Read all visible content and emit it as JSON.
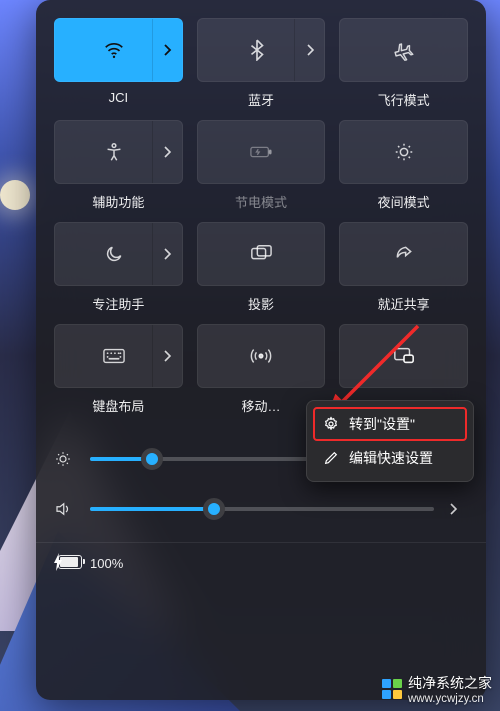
{
  "tiles": [
    {
      "id": "wifi",
      "label": "JCI",
      "icon": "wifi-icon",
      "active": true,
      "hasChevron": true,
      "disabled": false
    },
    {
      "id": "bluetooth",
      "label": "蓝牙",
      "icon": "bluetooth-icon",
      "active": false,
      "hasChevron": true,
      "disabled": false
    },
    {
      "id": "airplane",
      "label": "飞行模式",
      "icon": "airplane-icon",
      "active": false,
      "hasChevron": false,
      "disabled": false
    },
    {
      "id": "accessibility",
      "label": "辅助功能",
      "icon": "accessibility-icon",
      "active": false,
      "hasChevron": true,
      "disabled": false
    },
    {
      "id": "battery-saver",
      "label": "节电模式",
      "icon": "battery-saver-icon",
      "active": false,
      "hasChevron": false,
      "disabled": true
    },
    {
      "id": "night-light",
      "label": "夜间模式",
      "icon": "night-light-icon",
      "active": false,
      "hasChevron": false,
      "disabled": false
    },
    {
      "id": "focus",
      "label": "专注助手",
      "icon": "moon-icon",
      "active": false,
      "hasChevron": true,
      "disabled": false
    },
    {
      "id": "project",
      "label": "投影",
      "icon": "project-icon",
      "active": false,
      "hasChevron": false,
      "disabled": false
    },
    {
      "id": "share",
      "label": "就近共享",
      "icon": "share-icon",
      "active": false,
      "hasChevron": false,
      "disabled": false
    },
    {
      "id": "keyboard",
      "label": "键盘布局",
      "icon": "keyboard-icon",
      "active": false,
      "hasChevron": true,
      "disabled": false
    },
    {
      "id": "hotspot",
      "label": "移动…",
      "icon": "hotspot-icon",
      "active": false,
      "hasChevron": false,
      "disabled": false
    },
    {
      "id": "cast",
      "label": "",
      "icon": "cast-icon",
      "active": false,
      "hasChevron": false,
      "disabled": false
    }
  ],
  "sliders": {
    "brightness": {
      "value": 18
    },
    "volume": {
      "value": 36
    }
  },
  "battery": {
    "text": "100%"
  },
  "context_menu": {
    "go_to_settings": "转到\"设置\"",
    "edit_quick_settings": "编辑快速设置"
  },
  "watermark": {
    "title": "纯净系统之家",
    "url": "www.ycwjzy.cn",
    "colors": [
      "#2ea3ff",
      "#6ad24a",
      "#2ea3ff",
      "#ffc93c"
    ]
  }
}
